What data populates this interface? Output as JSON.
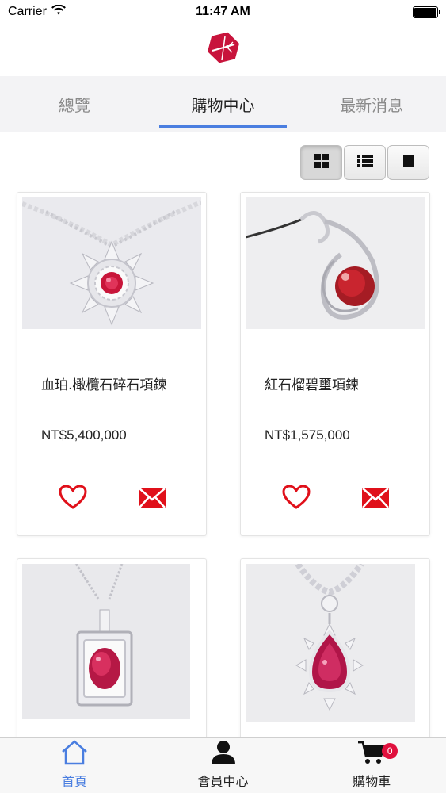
{
  "status_bar": {
    "carrier": "Carrier",
    "time": "11:47 AM",
    "battery_level": 1.0
  },
  "header": {
    "logo_icon": "ruby-logo-icon",
    "brand_color": "#c8143c"
  },
  "tabs": [
    {
      "label": "總覽",
      "active": false
    },
    {
      "label": "購物中心",
      "active": true
    },
    {
      "label": "最新消息",
      "active": false
    }
  ],
  "view_toggles": [
    {
      "icon": "grid-view-icon",
      "active": true
    },
    {
      "icon": "list-view-icon",
      "active": false
    },
    {
      "icon": "single-view-icon",
      "active": false
    }
  ],
  "products": [
    {
      "name": "血珀.橄欖石碎石項鍊",
      "price": "NT$5,400,000",
      "image_icon": "necklace-image"
    },
    {
      "name": "紅石榴碧璽項鍊",
      "price": "NT$1,575,000",
      "image_icon": "pendant-image"
    },
    {
      "name": "",
      "price": "",
      "image_icon": "ruby-pendant-image"
    },
    {
      "name": "",
      "price": "",
      "image_icon": "ruby-drop-pendant-image"
    }
  ],
  "bottom_nav": [
    {
      "label": "首頁",
      "icon": "home-icon",
      "active": true
    },
    {
      "label": "會員中心",
      "icon": "member-icon",
      "active": false
    },
    {
      "label": "購物車",
      "icon": "cart-icon",
      "active": false,
      "badge": "0"
    }
  ],
  "colors": {
    "accent": "#4a7ee0",
    "icon_red": "#e0101a",
    "badge": "#e0103d"
  }
}
